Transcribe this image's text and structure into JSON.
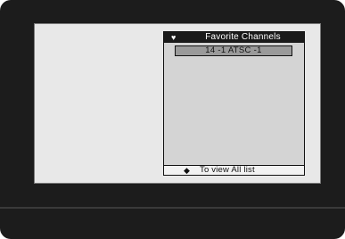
{
  "favorites_panel": {
    "title": "Favorite Channels",
    "heart_icon": "♥",
    "channels": [
      {
        "label": "14 -1 ATSC -1",
        "selected": true
      }
    ],
    "footer": {
      "icon": "◆",
      "label": "To view All list"
    }
  },
  "colors": {
    "bezel": "#1c1c1c",
    "screen": "#e8e8e8",
    "panel": "#d4d4d4",
    "header": "#1a1a1a",
    "selected_item": "#9a9a9a"
  }
}
